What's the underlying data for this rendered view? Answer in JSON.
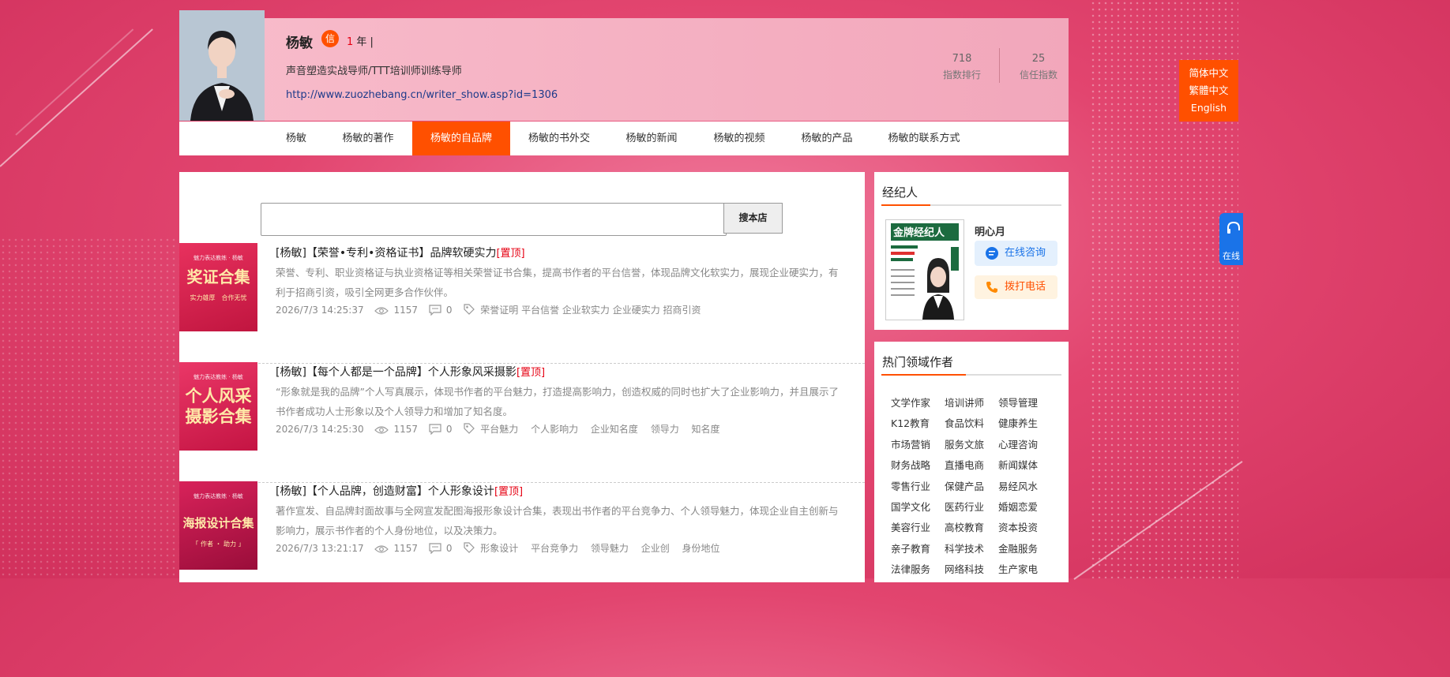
{
  "header": {
    "name": "杨敏",
    "badge": "信",
    "years_num": "1",
    "years_unit": "年 |",
    "intro": "声音塑造实战导师/TTT培训师训练导师",
    "url": "http://www.zuozhebang.cn/writer_show.asp?id=1306",
    "stats": [
      {
        "value": "718",
        "label": "指数排行"
      },
      {
        "value": "25",
        "label": "信任指数"
      }
    ]
  },
  "nav": {
    "items": [
      {
        "label": "杨敏"
      },
      {
        "label": "杨敏的著作"
      },
      {
        "label": "杨敏的自品牌"
      },
      {
        "label": "杨敏的书外交"
      },
      {
        "label": "杨敏的新闻"
      },
      {
        "label": "杨敏的视频"
      },
      {
        "label": "杨敏的产品"
      },
      {
        "label": "杨敏的联系方式"
      }
    ],
    "active_index": 2
  },
  "search": {
    "placeholder": "",
    "button": "搜本店"
  },
  "articles": [
    {
      "title": "[杨敏]【荣誉•专利•资格证书】品牌软硬实力",
      "top": "[置顶]",
      "desc": "荣誉、专利、职业资格证与执业资格证等相关荣誉证书合集，提高书作者的平台信誉，体现品牌文化软实力，展现企业硬实力，有利于招商引资，吸引全网更多合作伙伴。",
      "date": "2026/7/3 14:25:37",
      "views": "1157",
      "comments": "0",
      "tags": "荣誉证明 平台信誉 企业软实力 企业硬实力 招商引资",
      "thumb": {
        "small": "魅力表达教练 · 杨敏",
        "big": "奖证合集",
        "sub": "实力雄厚　合作无忧"
      }
    },
    {
      "title": "[杨敏]【每个人都是一个品牌】个人形象风采摄影",
      "top": "[置顶]",
      "desc": "“形象就是我的品牌”个人写真展示，体现书作者的平台魅力，打造提高影响力，创造权威的同时也扩大了企业影响力，并且展示了书作者成功人士形象以及个人领导力和增加了知名度。",
      "date": "2026/7/3 14:25:30",
      "views": "1157",
      "comments": "0",
      "tags": "平台魅力　 个人影响力　 企业知名度　 领导力　 知名度",
      "thumb": {
        "small": "魅力表达教练 · 杨敏",
        "big": "个人风采\n摄影合集",
        "sub": ""
      }
    },
    {
      "title": "[杨敏]【个人品牌，创造财富】个人形象设计",
      "top": "[置顶]",
      "desc": "著作宣发、自品牌封面故事与全网宣发配图海报形象设计合集，表现出书作者的平台竞争力、个人领导魅力，体现企业自主创新与影响力，展示书作者的个人身份地位，以及决策力。",
      "date": "2026/7/3 13:21:17",
      "views": "1157",
      "comments": "0",
      "tags": "形象设计　 平台竞争力　 领导魅力　 企业创　 身份地位",
      "thumb": {
        "small": "魅力表达教练 · 杨敏",
        "big": "海报设计合集",
        "sub": "「 作者 ・ 助力 」"
      }
    }
  ],
  "agent": {
    "section_title": "经纪人",
    "name": "明心月",
    "consult": "在线咨询",
    "call": "拨打电话",
    "card_title": "金牌经纪人"
  },
  "hot": {
    "section_title": "热门领域作者",
    "tags": [
      "文学作家",
      "培训讲师",
      "领导管理",
      "K12教育",
      "食品饮料",
      "健康养生",
      "市场营销",
      "服务文旅",
      "心理咨询",
      "财务战略",
      "直播电商",
      "新闻媒体",
      "零售行业",
      "保健产品",
      "易经风水",
      "国学文化",
      "医药行业",
      "婚姻恋爱",
      "美容行业",
      "高校教育",
      "资本投资",
      "亲子教育",
      "科学技术",
      "金融服务",
      "法律服务",
      "网络科技",
      "生产家电"
    ]
  },
  "lang": [
    "简体中文",
    "繁體中文",
    "English"
  ],
  "float_consult": "在线",
  "colors": {
    "accent": "#ff5000",
    "top_red": "#e60012",
    "link_blue": "#1d3a8a"
  }
}
